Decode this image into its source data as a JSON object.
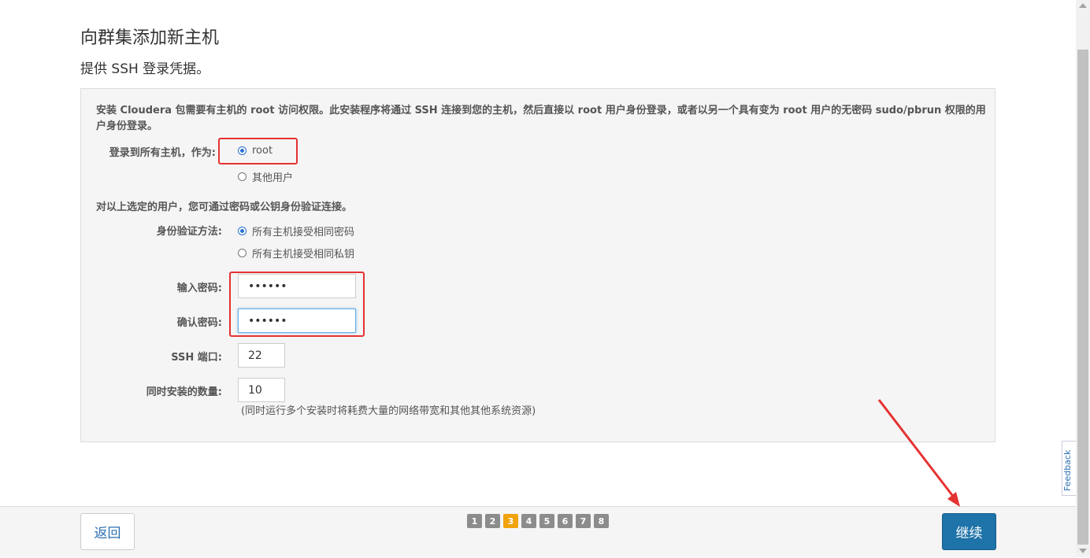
{
  "page": {
    "title": "向群集添加新主机",
    "subtitle": "提供 SSH 登录凭据。"
  },
  "panel": {
    "intro": "安装 Cloudera 包需要有主机的 root 访问权限。此安装程序将通过 SSH 连接到您的主机，然后直接以 root 用户身份登录，或者以另一个具有变为 root 用户的无密码 sudo/pbrun 权限的用户身份登录。",
    "login_label": "登录到所有主机，作为:",
    "login_options": [
      {
        "label": "root",
        "selected": true
      },
      {
        "label": "其他用户",
        "selected": false
      }
    ],
    "auth_note": "对以上选定的用户，您可通过密码或公钥身份验证连接。",
    "auth_method_label": "身份验证方法:",
    "auth_options": [
      {
        "label": "所有主机接受相同密码",
        "selected": true
      },
      {
        "label": "所有主机接受相同私钥",
        "selected": false
      }
    ],
    "password_label": "输入密码:",
    "password_value": "••••••",
    "confirm_label": "确认密码:",
    "confirm_value": "••••••",
    "ssh_port_label": "SSH 端口:",
    "ssh_port_value": "22",
    "concurrent_label": "同时安装的数量:",
    "concurrent_value": "10",
    "concurrent_hint": "(同时运行多个安装时将耗费大量的网络带宽和其他其他系统资源)"
  },
  "footer": {
    "back_label": "返回",
    "continue_label": "继续",
    "steps": [
      "1",
      "2",
      "3",
      "4",
      "5",
      "6",
      "7",
      "8"
    ],
    "current_step": 3
  },
  "feedback": {
    "label": "Feedback"
  },
  "colors": {
    "accent": "#1e73a8",
    "highlight": "#e53232",
    "current_step": "#f0a30a",
    "radio_selected": "#2a6fd6"
  }
}
